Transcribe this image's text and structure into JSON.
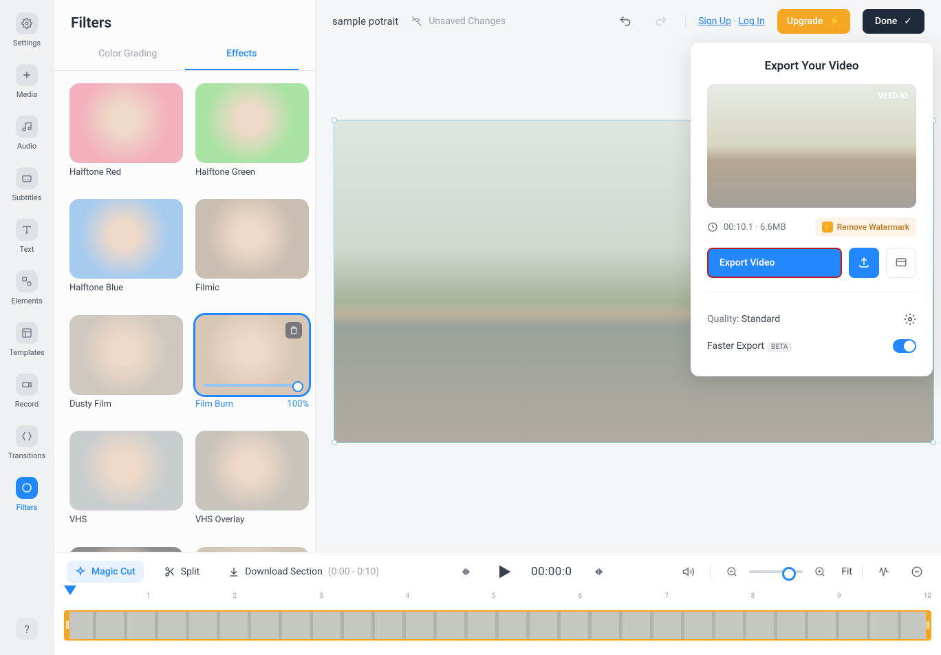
{
  "rail": [
    "Settings",
    "Media",
    "Audio",
    "Subtitles",
    "Text",
    "Elements",
    "Templates",
    "Record",
    "Transitions",
    "Filters"
  ],
  "rail_active": 9,
  "panel_title": "Filters",
  "tabs": {
    "grading": "Color Grading",
    "effects": "Effects",
    "active": "effects"
  },
  "effects": [
    {
      "name": "Halftone Red",
      "key": "halftone-red",
      "tint": "#f2b1bd"
    },
    {
      "name": "Halftone Green",
      "key": "halftone-green",
      "tint": "#a9e3a3"
    },
    {
      "name": "Halftone Blue",
      "key": "halftone-blue",
      "tint": "#a7cbef"
    },
    {
      "name": "Filmic",
      "key": "filmic",
      "tint": "#c9beb1"
    },
    {
      "name": "Dusty Film",
      "key": "dusty-film",
      "tint": "#cfc8bf"
    },
    {
      "name": "Film Burn",
      "key": "film-burn",
      "tint": "#d9c7b5",
      "selected": true,
      "intensity": "100%"
    },
    {
      "name": "VHS",
      "key": "vhs",
      "tint": "#c8cdcf"
    },
    {
      "name": "VHS Overlay",
      "key": "vhs-overlay",
      "tint": "#c8c3bb"
    },
    {
      "name": "",
      "key": "bw",
      "tint": "#8c8c8c"
    },
    {
      "name": "",
      "key": "glow",
      "tint": "#d1c7b8"
    }
  ],
  "project_title": "sample potrait",
  "unsaved": "Unsaved Changes",
  "auth": {
    "signup": "Sign Up",
    "login": "Log In"
  },
  "upgrade": "Upgrade",
  "done": "Done",
  "bottom": {
    "magic": "Magic Cut",
    "split": "Split",
    "download": "Download Section",
    "download_range": "(0:00 - 0:10)",
    "time": "00:00:0",
    "fit": "Fit",
    "ticks": [
      "",
      "1",
      "2",
      "3",
      "4",
      "5",
      "6",
      "7",
      "8",
      "9",
      "10"
    ]
  },
  "export": {
    "title": "Export Your Video",
    "watermark_brand": "VEED.IO",
    "info": "00:10.1 · 6.6MB",
    "remove_wm": "Remove Watermark",
    "button": "Export Video",
    "quality_label": "Quality:",
    "quality_value": "Standard",
    "faster": "Faster Export",
    "beta": "BETA"
  }
}
